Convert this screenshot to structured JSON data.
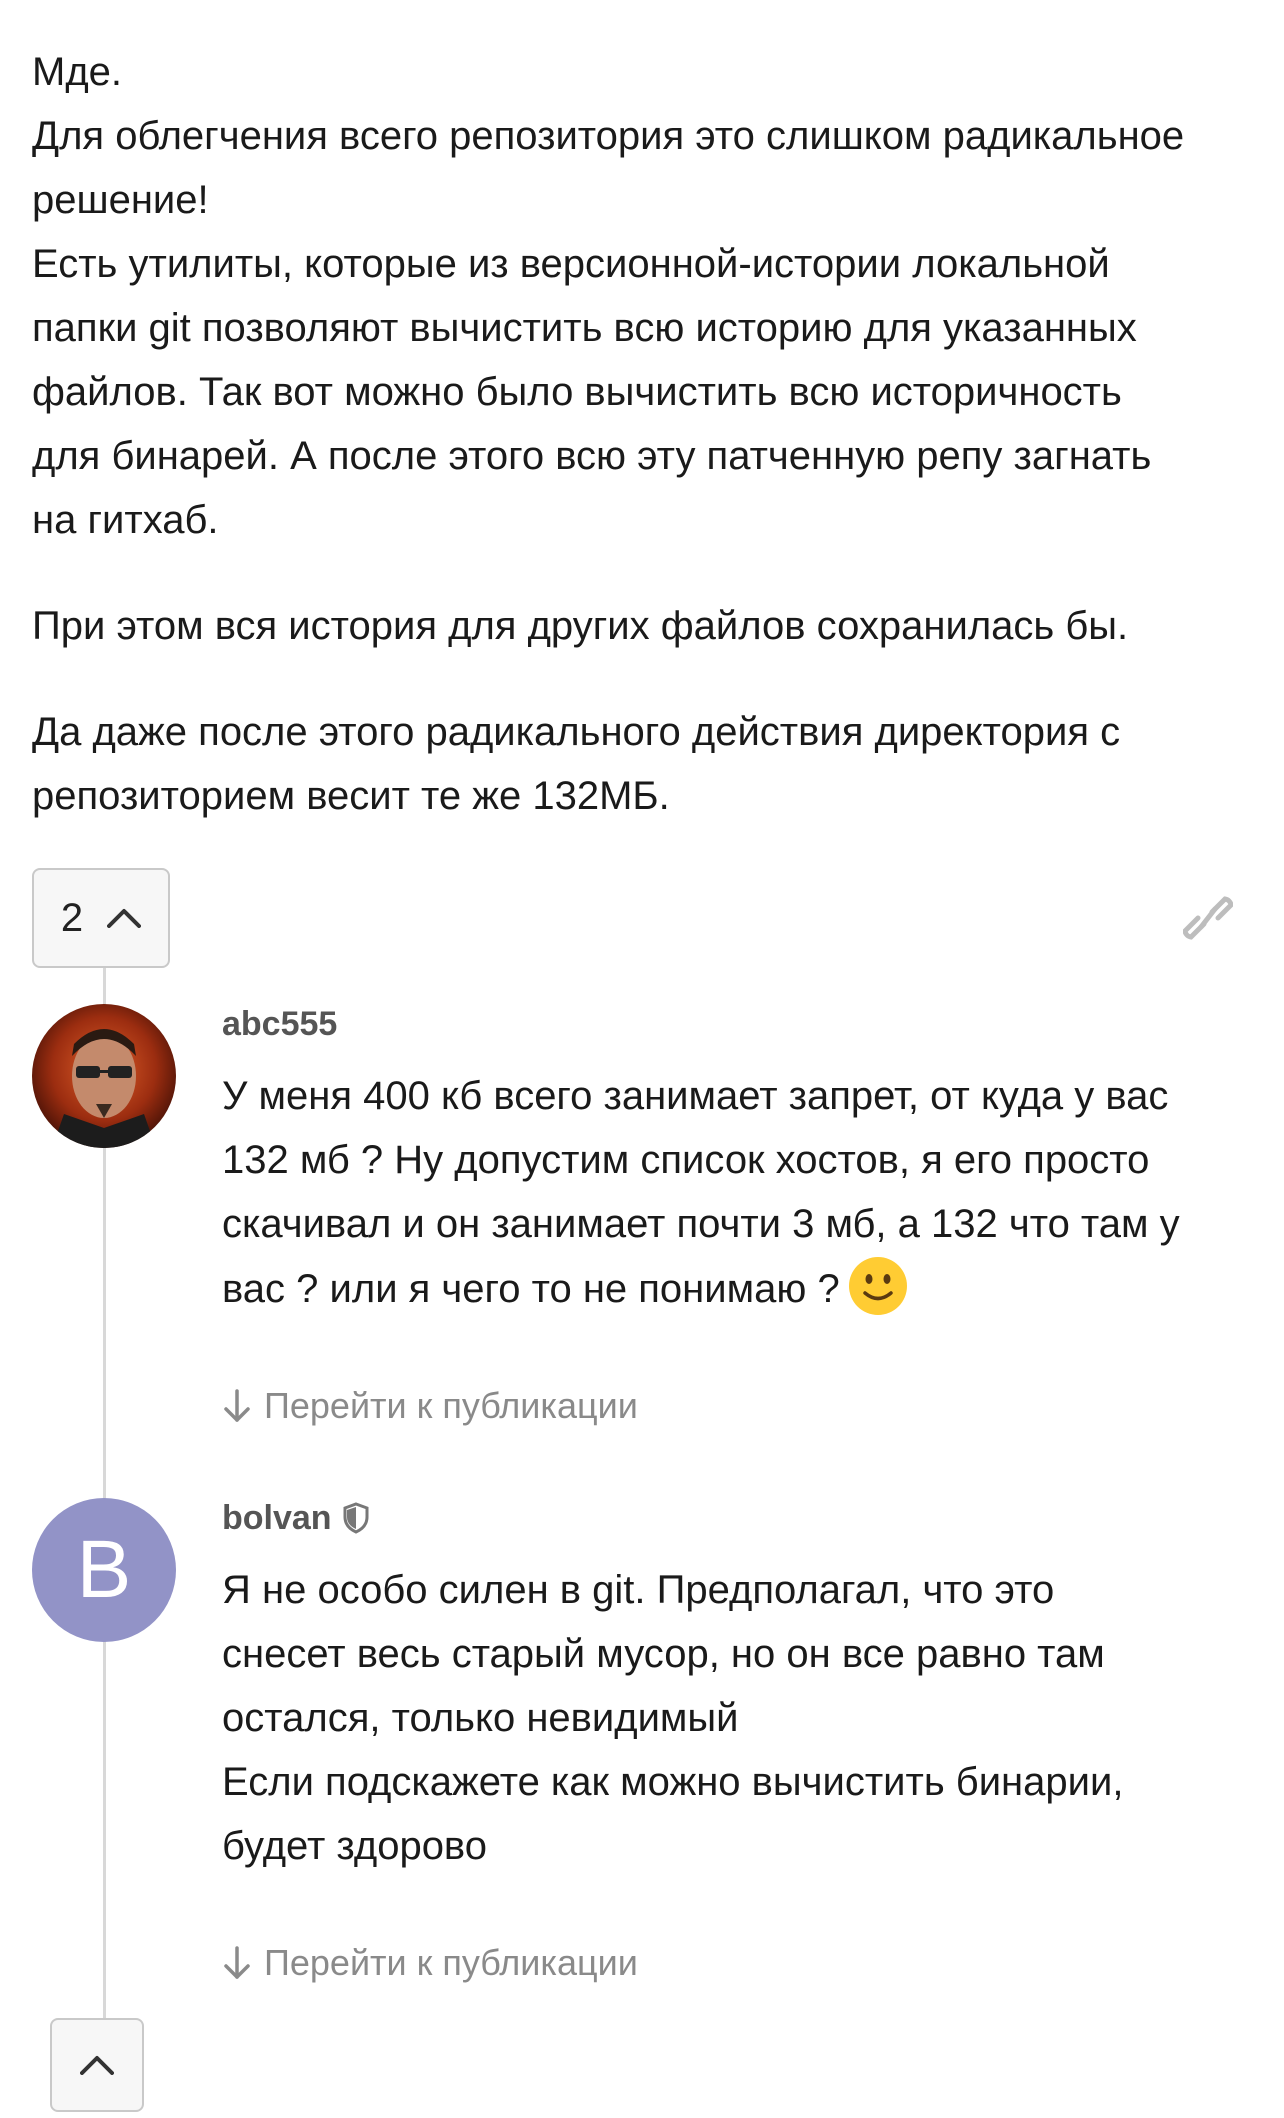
{
  "post": {
    "paragraphs": [
      [
        "Мде.",
        "Для облегчения всего репозитория это слишком радикальное",
        "решение!",
        "Есть утилиты, которые из версионной-истории локальной",
        "папки git позволяют вычистить всю историю для указанных",
        "файлов. Так вот можно было вычистить всю историчность",
        "для бинарей. А после этого всю эту патченную репу загнать",
        "на гитхаб."
      ],
      [
        "При этом вся история для других файлов сохранилась бы."
      ],
      [
        "Да даже после этого радикального действия директория с",
        "репозиторием весит те же 132МБ."
      ]
    ],
    "vote_count": "2",
    "vote_icon": "chevron-up-icon",
    "link_icon": "link-icon"
  },
  "comments": [
    {
      "author": "abc555",
      "avatar": "character-portrait",
      "lines": [
        "У меня 400 кб всего занимает запрет, от куда у вас",
        "132 мб ? Ну допустим список хостов, я его просто",
        "скачивал и он занимает почти 3 мб, а 132 что там у",
        "вас ? или я чего то не понимаю ?"
      ],
      "emoji": "slightly-smiling-face-icon",
      "goto_label": "Перейти к публикации"
    },
    {
      "author": "bolvan",
      "avatar_letter": "B",
      "avatar_color": "#9293c7",
      "badge_icon": "shield-icon",
      "lines": [
        "Я не особо силен в git. Предполагал, что это",
        "снесет весь старый мусор, но он все равно там",
        "остался, только невидимый",
        "Если подскажете как можно вычистить бинарии,",
        "будет здорово"
      ],
      "goto_label": "Перейти к публикации"
    }
  ],
  "collapse_icon": "chevron-up-icon"
}
